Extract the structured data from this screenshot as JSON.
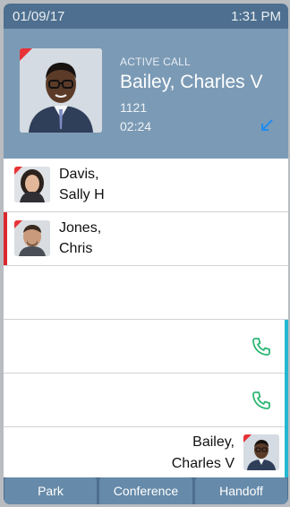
{
  "status": {
    "date": "01/09/17",
    "time": "1:31 PM"
  },
  "active_call": {
    "label": "ACTIVE CALL",
    "name": "Bailey, Charles V",
    "extension": "1121",
    "duration": "02:24",
    "direction_icon": "incoming-arrow-icon"
  },
  "contacts": [
    {
      "first_line": "Davis,",
      "second_line": "Sally H"
    },
    {
      "first_line": "Jones,",
      "second_line": "Chris"
    }
  ],
  "bottom_contact": {
    "first_line": "Bailey,",
    "second_line": "Charles V"
  },
  "softkeys": [
    "Park",
    "Conference",
    "Handoff"
  ],
  "colors": {
    "status_bar": "#4e6f8f",
    "active_panel": "#7b9ab5",
    "accent_red": "#d9272e",
    "accent_cyan": "#22b8d3",
    "phone_green": "#2bb673"
  }
}
